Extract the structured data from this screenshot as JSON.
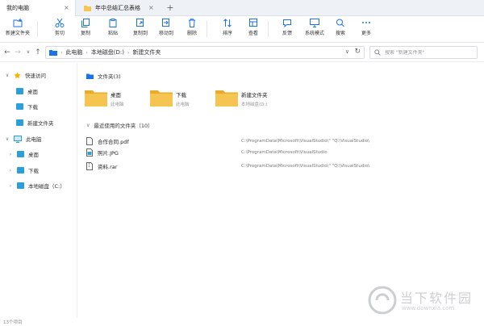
{
  "tabs": [
    {
      "label": "我的电脑"
    },
    {
      "label": "年中总结汇总表格"
    }
  ],
  "toolbar": [
    {
      "label": "新建文件夹",
      "icon": "new-folder-icon"
    },
    {
      "label": "剪切",
      "icon": "cut-icon"
    },
    {
      "label": "复制",
      "icon": "copy-icon"
    },
    {
      "label": "粘贴",
      "icon": "paste-icon"
    },
    {
      "label": "复制到",
      "icon": "copy-to-icon"
    },
    {
      "label": "移动到",
      "icon": "move-to-icon"
    },
    {
      "label": "删除",
      "icon": "delete-icon"
    },
    {
      "label": "排序",
      "icon": "sort-icon"
    },
    {
      "label": "查看",
      "icon": "view-icon"
    },
    {
      "label": "反馈",
      "icon": "feedback-icon"
    },
    {
      "label": "系统模式",
      "icon": "system-mode-icon"
    },
    {
      "label": "搜索",
      "icon": "search-icon"
    },
    {
      "label": "更多",
      "icon": "more-icon"
    }
  ],
  "address": {
    "crumbs": [
      "此电脑",
      "本地磁盘(D:)",
      "新建文件夹"
    ],
    "search_placeholder": "搜索 \"新建文件夹\""
  },
  "sidebar": {
    "quick_access": "快速访问",
    "quick_items": [
      "桌面",
      "下载",
      "新建文件夹"
    ],
    "this_pc": "此电脑",
    "pc_items": [
      "桌面",
      "下载",
      "本地磁盘（C:）"
    ]
  },
  "main": {
    "folders_header": "文件夹(3)",
    "folders": [
      {
        "name": "桌面",
        "location": "此电脑"
      },
      {
        "name": "下载",
        "location": "此电脑"
      },
      {
        "name": "新建文件夹",
        "location": "本地磁盘(D:)"
      }
    ],
    "recent_header": "最近使用的文件夹（10）",
    "recent": [
      {
        "name": "合作合同.pdf",
        "path": "C:\\ProgramData\\Microsoft\\VisualStudio\\\" \"Q:\\VisualStudio\\"
      },
      {
        "name": "照片.JPG",
        "path": "C:\\ProgramData\\Microsoft\\VisualStudio"
      },
      {
        "name": "资料.rar",
        "path": "C:\\ProgramData\\Microsoft\\VisualStudio\\\" \"Q:\\VisualStudio\\"
      }
    ]
  },
  "status": {
    "count": "13个项目"
  },
  "watermark": {
    "title": "当下软件园",
    "url": "www.downxia.com"
  },
  "colors": {
    "accent": "#1a73e8",
    "folder": "#f5c451",
    "folder_dark": "#e8ac2c"
  }
}
